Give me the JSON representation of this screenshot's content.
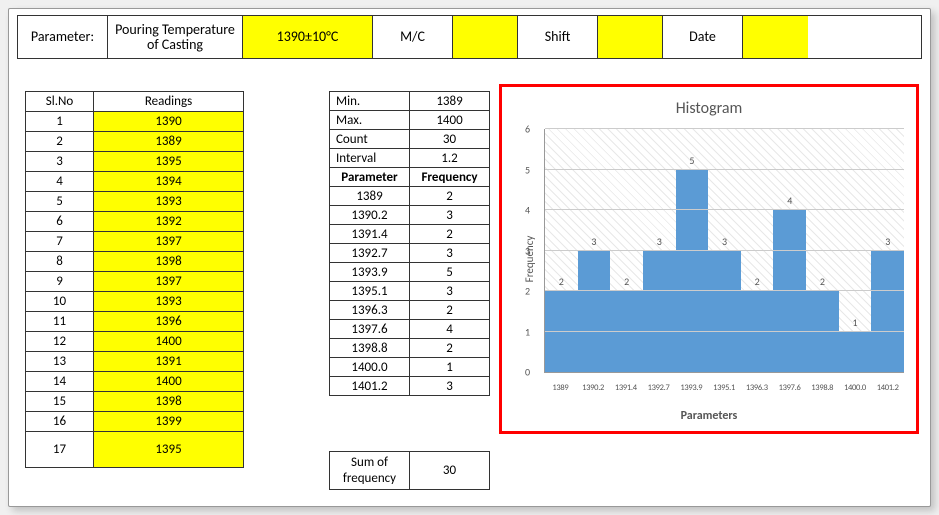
{
  "param_bar": {
    "label": "Parameter:",
    "name": "Pouring Temperature of Casting",
    "value": "1390±10°C",
    "mc": "M/C",
    "shift": "Shift",
    "date": "Date"
  },
  "readings_header": {
    "slno": "Sl.No",
    "readings": "Readings"
  },
  "readings": [
    {
      "n": 1,
      "v": 1390
    },
    {
      "n": 2,
      "v": 1389
    },
    {
      "n": 3,
      "v": 1395
    },
    {
      "n": 4,
      "v": 1394
    },
    {
      "n": 5,
      "v": 1393
    },
    {
      "n": 6,
      "v": 1392
    },
    {
      "n": 7,
      "v": 1397
    },
    {
      "n": 8,
      "v": 1398
    },
    {
      "n": 9,
      "v": 1397
    },
    {
      "n": 10,
      "v": 1393
    },
    {
      "n": 11,
      "v": 1396
    },
    {
      "n": 12,
      "v": 1400
    },
    {
      "n": 13,
      "v": 1391
    },
    {
      "n": 14,
      "v": 1400
    },
    {
      "n": 15,
      "v": 1398
    },
    {
      "n": 16,
      "v": 1399
    },
    {
      "n": 17,
      "v": 1395
    }
  ],
  "stats": {
    "min_l": "Min.",
    "min_v": "1389",
    "max_l": "Max.",
    "max_v": "1400",
    "count_l": "Count",
    "count_v": "30",
    "interval_l": "Interval",
    "interval_v": "1.2",
    "param_hdr": "Parameter",
    "freq_hdr": "Frequency",
    "rows": [
      {
        "p": "1389",
        "f": "2"
      },
      {
        "p": "1390.2",
        "f": "3"
      },
      {
        "p": "1391.4",
        "f": "2"
      },
      {
        "p": "1392.7",
        "f": "3"
      },
      {
        "p": "1393.9",
        "f": "5"
      },
      {
        "p": "1395.1",
        "f": "3"
      },
      {
        "p": "1396.3",
        "f": "2"
      },
      {
        "p": "1397.6",
        "f": "4"
      },
      {
        "p": "1398.8",
        "f": "2"
      },
      {
        "p": "1400.0",
        "f": "1"
      },
      {
        "p": "1401.2",
        "f": "3"
      }
    ]
  },
  "sum": {
    "label": "Sum of frequency",
    "value": "30"
  },
  "chart_data": {
    "type": "bar",
    "title": "Histogram",
    "xlabel": "Parameters",
    "ylabel": "Frequency",
    "ylim": [
      0,
      6
    ],
    "yticks": [
      0,
      1,
      2,
      3,
      4,
      5,
      6
    ],
    "categories": [
      "1389",
      "1390.2",
      "1391.4",
      "1392.7",
      "1393.9",
      "1395.1",
      "1396.3",
      "1397.6",
      "1398.8",
      "1400.0",
      "1401.2"
    ],
    "values": [
      2,
      3,
      2,
      3,
      5,
      3,
      2,
      4,
      2,
      1,
      3
    ]
  }
}
